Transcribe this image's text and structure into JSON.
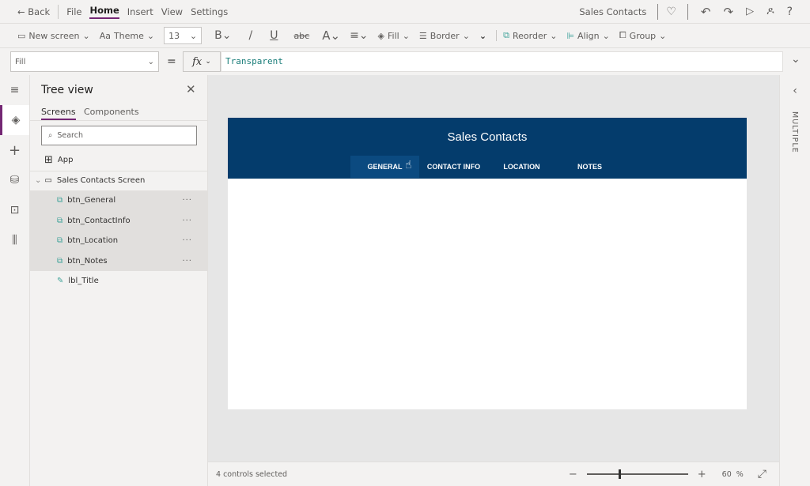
{
  "topbar": {
    "back": "Back",
    "menus": [
      "File",
      "Home",
      "Insert",
      "View",
      "Settings"
    ],
    "app_name": "Sales Contacts"
  },
  "toolbar": {
    "new_screen": "New screen",
    "theme": "Theme",
    "font_size": "13",
    "fill": "Fill",
    "border": "Border",
    "reorder": "Reorder",
    "align": "Align",
    "group": "Group"
  },
  "formula": {
    "property": "Fill",
    "equals": "=",
    "fx": "fx",
    "value": "Transparent"
  },
  "tree": {
    "title": "Tree view",
    "tabs": [
      "Screens",
      "Components"
    ],
    "search_placeholder": "Search",
    "app": "App",
    "screen": "Sales Contacts Screen",
    "items": [
      {
        "label": "btn_General",
        "selected": true
      },
      {
        "label": "btn_ContactInfo",
        "selected": true
      },
      {
        "label": "btn_Location",
        "selected": true
      },
      {
        "label": "btn_Notes",
        "selected": true
      },
      {
        "label": "lbl_Title",
        "selected": false
      }
    ]
  },
  "app": {
    "title": "Sales Contacts",
    "tabs": [
      "GENERAL",
      "CONTACT INFO",
      "LOCATION",
      "NOTES"
    ],
    "header_color": "#043c6c"
  },
  "status": {
    "selection": "4 controls selected",
    "zoom": "60",
    "zoom_unit": "%",
    "zoom_level": 0.6
  },
  "right_panel": {
    "label": "MULTIPLE"
  }
}
